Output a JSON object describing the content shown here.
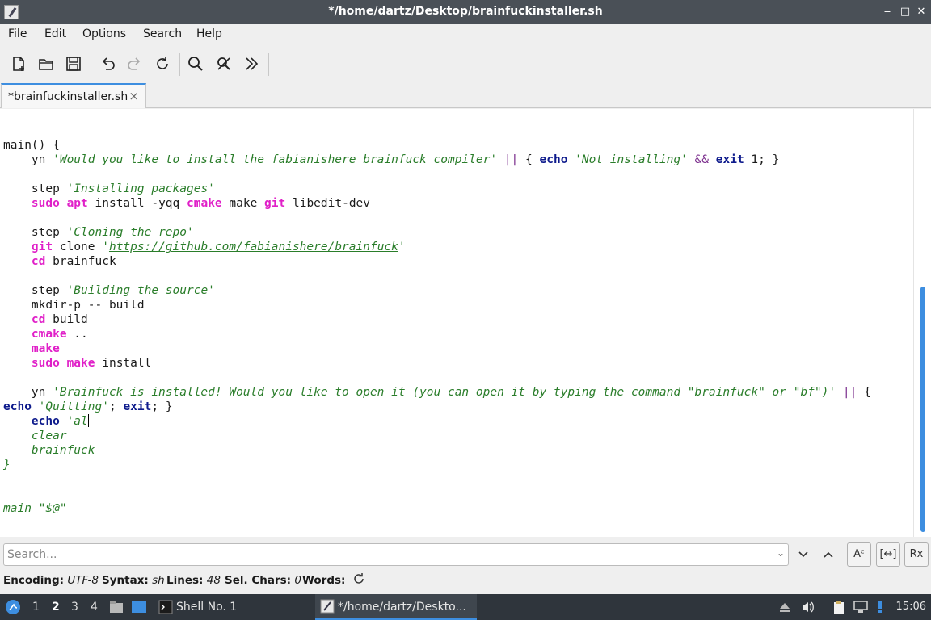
{
  "window": {
    "title": "*/home/dartz/Desktop/brainfuckinstaller.sh",
    "controls": {
      "minimize": "‒",
      "maximize": "□",
      "close": "✕"
    }
  },
  "menu": {
    "items": [
      "File",
      "Edit",
      "Options",
      "Search",
      "Help"
    ]
  },
  "toolbar": {
    "buttons": [
      {
        "icon": "new-file-icon"
      },
      {
        "icon": "open-folder-icon"
      },
      {
        "icon": "save-icon"
      },
      {
        "icon": "undo-icon"
      },
      {
        "icon": "redo-icon"
      },
      {
        "icon": "reload-icon"
      },
      {
        "icon": "search-icon"
      },
      {
        "icon": "search-replace-icon"
      },
      {
        "icon": "more-chevron-icon"
      }
    ]
  },
  "tab": {
    "label": "*brainfuckinstaller.sh",
    "close": "×"
  },
  "editor": {
    "lines": [
      "main() {",
      "    yn 'Would you like to install the fabianishere brainfuck compiler' || { echo 'Not installing' && exit 1; }",
      "",
      "    step 'Installing packages'",
      "    sudo apt install -yqq cmake make git libedit-dev",
      "",
      "    step 'Cloning the repo'",
      "    git clone 'https://github.com/fabianishere/brainfuck'",
      "    cd brainfuck",
      "",
      "    step 'Building the source'",
      "    mkdir-p -- build",
      "    cd build",
      "    cmake ..",
      "    make",
      "    sudo make install",
      "",
      "    yn 'Brainfuck is installed! Would you like to open it (you can open it by typing the command \"brainfuck\" or \"bf\")' || {",
      "echo 'Quitting'; exit; }",
      "    echo 'al",
      "    clear",
      "    brainfuck",
      "}",
      "",
      "",
      "main \"$@\""
    ]
  },
  "search": {
    "placeholder": "Search...",
    "value": ""
  },
  "search_buttons": {
    "down": "⌄",
    "up": "⌃",
    "match_case": "Aᶜ",
    "whole_word": "[↔]",
    "regex": "Rx"
  },
  "status": {
    "encoding_label": "Encoding:",
    "encoding": "UTF-8",
    "syntax_label": "Syntax:",
    "syntax": "sh",
    "lines_label": "Lines:",
    "lines": "48",
    "sel_label": "Sel. Chars:",
    "sel": "0",
    "words_label": "Words:"
  },
  "taskbar": {
    "workspaces": [
      "1",
      "2",
      "3",
      "4"
    ],
    "active_workspace": "2",
    "tasks": [
      {
        "label": "Shell No. 1",
        "icon": "terminal-icon"
      },
      {
        "label": "*/home/dartz/Deskto...",
        "icon": "text-editor-icon"
      }
    ],
    "clock": "15:06"
  },
  "colors": {
    "accent": "#3d8ee0",
    "keyword": "#0d1a8c",
    "command": "#e020c8",
    "string": "#2a7d2a"
  }
}
